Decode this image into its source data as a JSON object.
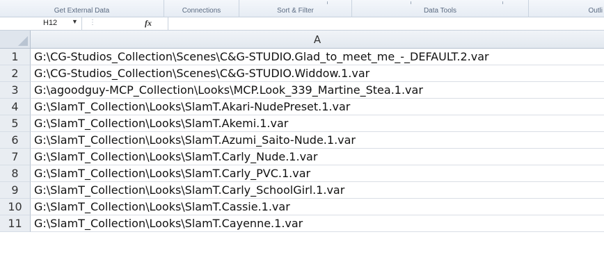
{
  "ribbon": {
    "groups": [
      "Get External Data",
      "Connections",
      "Sort & Filter",
      "Data Tools",
      "Outli"
    ]
  },
  "formula_bar": {
    "name_box": "H12",
    "fx_label": "fx"
  },
  "sheet": {
    "column_header": "A",
    "rows": [
      {
        "num": "1",
        "value": "G:\\CG-Studios_Collection\\Scenes\\C&G-STUDIO.Glad_to_meet_me_-_DEFAULT.2.var"
      },
      {
        "num": "2",
        "value": "G:\\CG-Studios_Collection\\Scenes\\C&G-STUDIO.Widdow.1.var"
      },
      {
        "num": "3",
        "value": "G:\\agoodguy-MCP_Collection\\Looks\\MCP.Look_339_Martine_Stea.1.var"
      },
      {
        "num": "4",
        "value": "G:\\SlamT_Collection\\Looks\\SlamT.Akari-NudePreset.1.var"
      },
      {
        "num": "5",
        "value": "G:\\SlamT_Collection\\Looks\\SlamT.Akemi.1.var"
      },
      {
        "num": "6",
        "value": "G:\\SlamT_Collection\\Looks\\SlamT.Azumi_Saito-Nude.1.var"
      },
      {
        "num": "7",
        "value": "G:\\SlamT_Collection\\Looks\\SlamT.Carly_Nude.1.var"
      },
      {
        "num": "8",
        "value": "G:\\SlamT_Collection\\Looks\\SlamT.Carly_PVC.1.var"
      },
      {
        "num": "9",
        "value": "G:\\SlamT_Collection\\Looks\\SlamT.Carly_SchoolGirl.1.var"
      },
      {
        "num": "10",
        "value": "G:\\SlamT_Collection\\Looks\\SlamT.Cassie.1.var"
      },
      {
        "num": "11",
        "value": "G:\\SlamT_Collection\\Looks\\SlamT.Cayenne.1.var"
      }
    ]
  }
}
